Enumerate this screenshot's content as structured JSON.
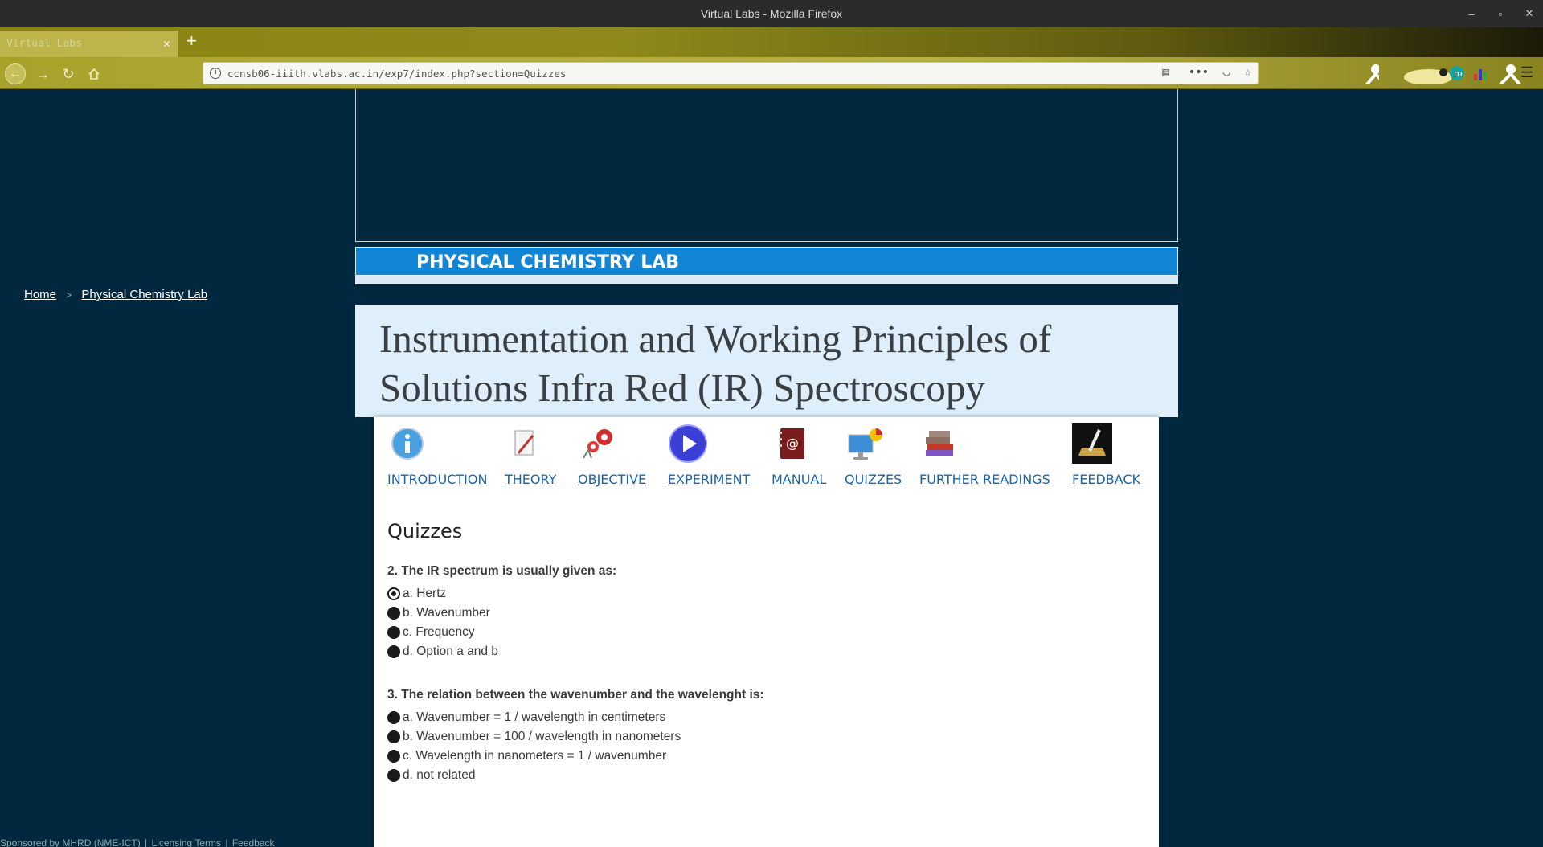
{
  "window": {
    "title": "Virtual Labs - Mozilla Firefox"
  },
  "tab": {
    "title": "Virtual Labs"
  },
  "urlbar": {
    "url": "ccnsb06-iiith.vlabs.ac.in/exp7/index.php?section=Quizzes"
  },
  "header": {
    "lab_name": "PHYSICAL CHEMISTRY LAB"
  },
  "breadcrumb": {
    "home": "Home",
    "lab": "Physical Chemistry Lab"
  },
  "experiment": {
    "title": "Instrumentation and Working Principles of Solutions Infra Red (IR) Spectroscopy"
  },
  "menu": {
    "items": [
      {
        "label": "INTRODUCTION",
        "icon": "info-icon"
      },
      {
        "label": "THEORY",
        "icon": "pencil-paper-icon"
      },
      {
        "label": "OBJECTIVE",
        "icon": "gears-icon"
      },
      {
        "label": "EXPERIMENT",
        "icon": "play-icon"
      },
      {
        "label": "MANUAL",
        "icon": "address-book-icon"
      },
      {
        "label": "QUIZZES",
        "icon": "computer-icon"
      },
      {
        "label": "FURTHER READINGS",
        "icon": "books-icon"
      },
      {
        "label": "FEEDBACK",
        "icon": "quill-icon"
      }
    ]
  },
  "section": {
    "title": "Quizzes"
  },
  "questions": [
    {
      "text": "2. The IR spectrum is usually given as:",
      "options": [
        "a. Hertz",
        "b. Wavenumber",
        "c. Frequency",
        "d. Option a and b"
      ],
      "selected": 0
    },
    {
      "text": "3. The relation between the wavenumber and the wavelenght is:",
      "options": [
        "a. Wavenumber = 1 / wavelength in centimeters",
        "b. Wavenumber = 100 / wavelength in nanometers",
        "c. Wavelength in nanometers = 1 / wavenumber",
        "d. not related"
      ],
      "selected": -1
    }
  ],
  "footer": {
    "sponsor": "Sponsored by MHRD (NME-ICT)",
    "licensing": "Licensing Terms",
    "feedback": "Feedback"
  }
}
